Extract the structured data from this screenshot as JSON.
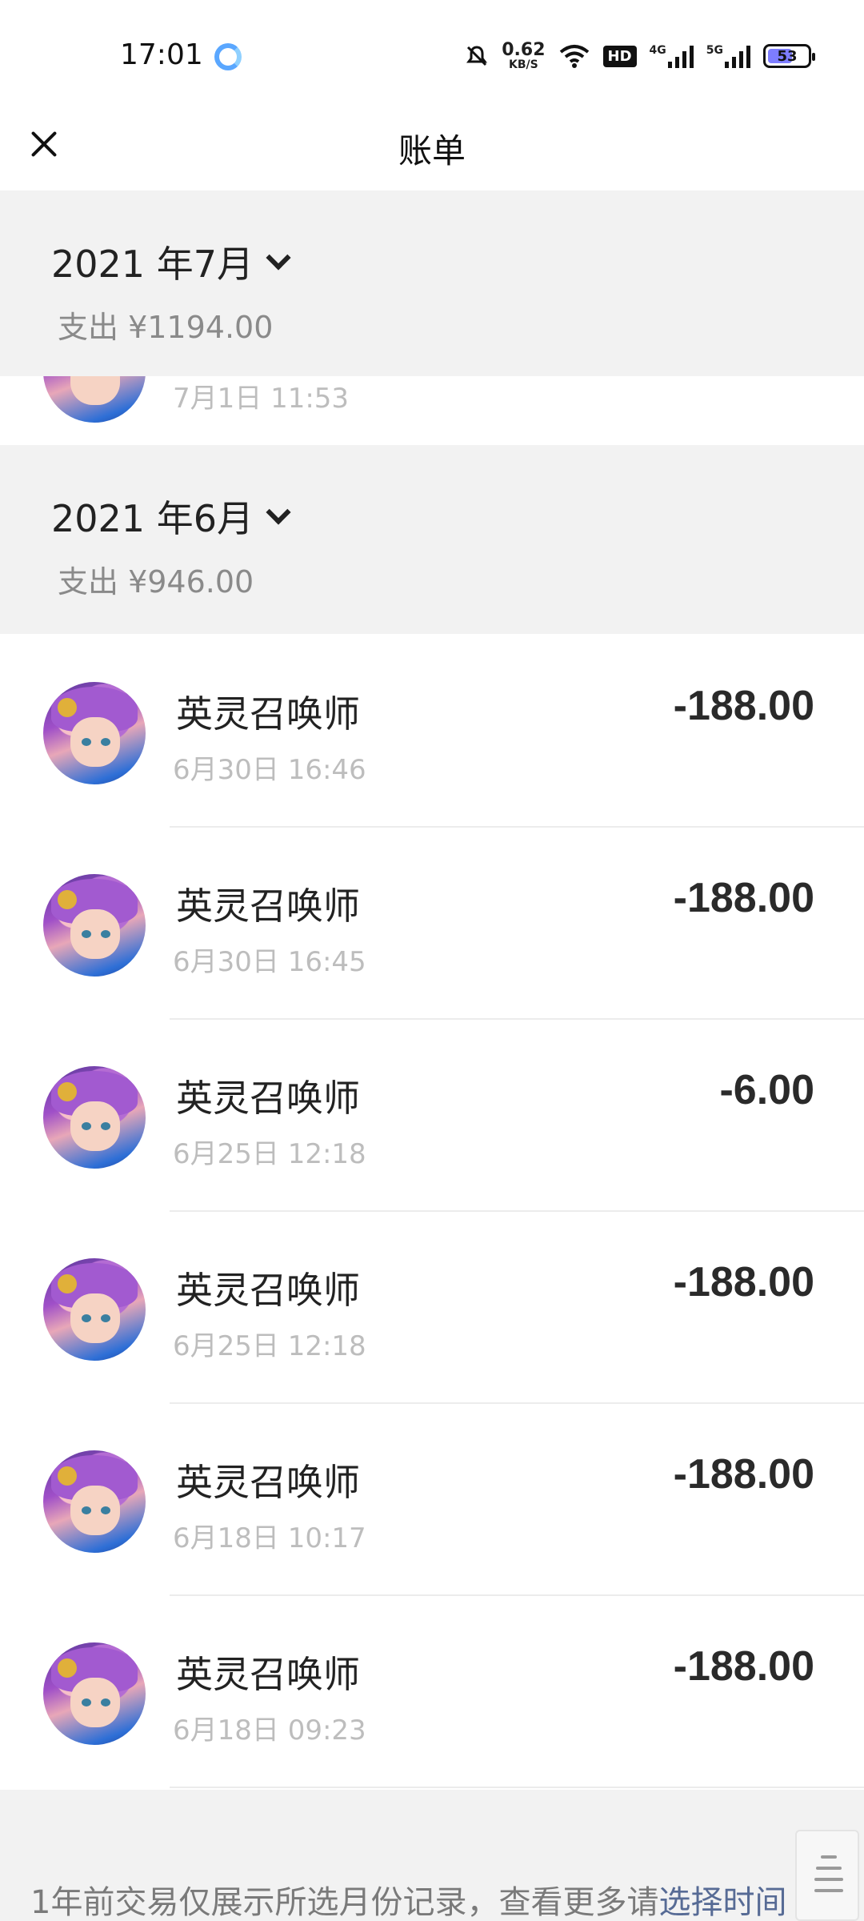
{
  "status_bar": {
    "time": "17:01",
    "net_speed_value": "0.62",
    "net_speed_unit": "KB/S",
    "hd_label": "HD",
    "sim1_label": "4G",
    "sim2_label": "5G",
    "battery": "53",
    "icons": [
      "app-notification-icon",
      "mute-bell-icon",
      "wifi-icon",
      "hd-icon",
      "signal-4g-icon",
      "signal-5g-icon",
      "battery-icon"
    ]
  },
  "header": {
    "title": "账单",
    "close_icon": "close-icon"
  },
  "months": [
    {
      "title": "2021 年7月",
      "summary": "支出 ¥1194.00",
      "partial_item_time": "7月1日 11:53"
    },
    {
      "title": "2021 年6月",
      "summary": "支出 ¥946.00"
    }
  ],
  "transactions": [
    {
      "name": "英灵召唤师",
      "time": "6月30日 16:46",
      "amount": "-188.00"
    },
    {
      "name": "英灵召唤师",
      "time": "6月30日 16:45",
      "amount": "-188.00"
    },
    {
      "name": "英灵召唤师",
      "time": "6月25日 12:18",
      "amount": "-6.00"
    },
    {
      "name": "英灵召唤师",
      "time": "6月25日 12:18",
      "amount": "-188.00"
    },
    {
      "name": "英灵召唤师",
      "time": "6月18日 10:17",
      "amount": "-188.00"
    },
    {
      "name": "英灵召唤师",
      "time": "6月18日 09:23",
      "amount": "-188.00"
    }
  ],
  "footer": {
    "note": "1年前交易仅展示所选月份记录，查看更多请",
    "link": "选择时间"
  },
  "colors": {
    "link": "#576b95",
    "section_bg": "#f2f2f2",
    "muted_text": "#bdbdbd"
  }
}
